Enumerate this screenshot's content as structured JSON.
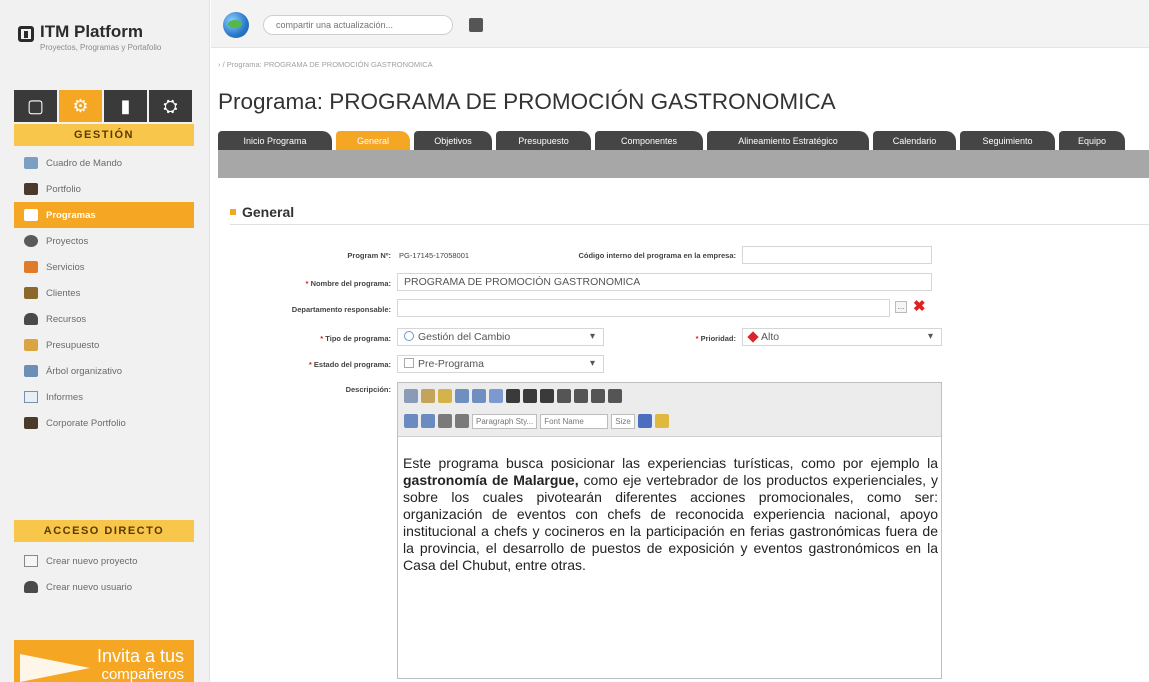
{
  "app": {
    "logo_title": "ITM Platform",
    "logo_subtitle": "Proyectos, Programas y Portafolio"
  },
  "topbar": {
    "status_placeholder": "compartir una actualización..."
  },
  "sidebar": {
    "section_gestion": "GESTIÓN",
    "items": [
      {
        "label": "Cuadro de Mando",
        "icon": "monitor-icon"
      },
      {
        "label": "Portfolio",
        "icon": "briefcase-icon"
      },
      {
        "label": "Programas",
        "icon": "program-icon",
        "active": true
      },
      {
        "label": "Proyectos",
        "icon": "project-icon"
      },
      {
        "label": "Servicios",
        "icon": "services-icon"
      },
      {
        "label": "Clientes",
        "icon": "clients-icon"
      },
      {
        "label": "Recursos",
        "icon": "person-icon"
      },
      {
        "label": "Presupuesto",
        "icon": "budget-icon"
      },
      {
        "label": "Árbol organizativo",
        "icon": "org-tree-icon"
      },
      {
        "label": "Informes",
        "icon": "reports-icon"
      },
      {
        "label": "Corporate Portfolio",
        "icon": "briefcase-icon"
      }
    ],
    "section_acceso": "ACCESO DIRECTO",
    "shortcuts": [
      {
        "label": "Crear nuevo proyecto",
        "icon": "new-project-icon"
      },
      {
        "label": "Crear nuevo usuario",
        "icon": "new-user-icon"
      }
    ],
    "invite_line1": "Invita a tus",
    "invite_line2": "compañeros"
  },
  "main": {
    "breadcrumb": "› / Programa: PROGRAMA DE PROMOCIÓN GASTRONOMICA",
    "title": "Programa: PROGRAMA DE PROMOCIÓN GASTRONOMICA",
    "tabs": [
      {
        "label": "Inicio Programa"
      },
      {
        "label": "General",
        "active": true
      },
      {
        "label": "Objetivos"
      },
      {
        "label": "Presupuesto"
      },
      {
        "label": "Componentes"
      },
      {
        "label": "Alineamiento Estratégico"
      },
      {
        "label": "Calendario"
      },
      {
        "label": "Seguimiento"
      },
      {
        "label": "Equipo"
      }
    ],
    "section_title": "General"
  },
  "form": {
    "program_no_label": "Program Nº:",
    "program_no_value": "PG-17145-17058001",
    "codigo_label": "Código interno del programa en la empresa:",
    "codigo_value": "",
    "nombre_label": "Nombre del programa:",
    "nombre_value": "PROGRAMA DE PROMOCIÓN GASTRONOMICA",
    "depto_label": "Departamento responsable:",
    "depto_value": "",
    "tipo_label": "Tipo de programa:",
    "tipo_value": "Gestión del Cambio",
    "prioridad_label": "Prioridad:",
    "prioridad_value": "Alto",
    "estado_label": "Estado del programa:",
    "estado_value": "Pre-Programa",
    "descripcion_label": "Descripción:",
    "required_mark": "*",
    "dots_label": "...",
    "remove_label": "✖"
  },
  "editor": {
    "paragraph_style": "Paragraph Sty...",
    "font_name": "Font Name",
    "size": "Size",
    "body_part1": "Este programa busca posicionar las experiencias turísticas, como por ejemplo la ",
    "body_bold": "gastronomía de Malargue,",
    "body_part2": " como eje vertebrador de los productos experienciales, y sobre los cuales pivotearán diferentes acciones promocionales, como ser: organización de eventos con chefs de reconocida experiencia nacional, apoyo institucional a chefs y cocineros en la participación en ferias gastronómicas fuera de la provincia, el desarrollo de puestos de exposición y eventos gastronómicos en la Casa del Chubut, entre otras."
  },
  "colors": {
    "accent": "#f5a623",
    "section_head": "#f8c64a",
    "tab_dark": "#454545",
    "tab_strip": "#a7a7a7",
    "required": "#e02020"
  }
}
